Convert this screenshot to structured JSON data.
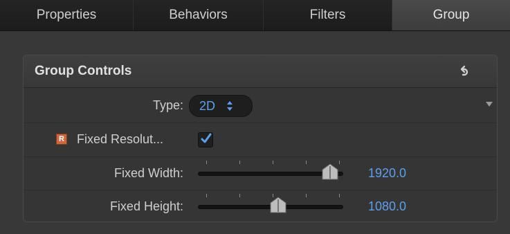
{
  "tabs": [
    {
      "label": "Properties",
      "active": false
    },
    {
      "label": "Behaviors",
      "active": false
    },
    {
      "label": "Filters",
      "active": false
    },
    {
      "label": "Group",
      "active": true
    }
  ],
  "panel": {
    "title": "Group Controls",
    "reset_icon": "reset-arrow-icon"
  },
  "rows": {
    "type": {
      "label": "Type:",
      "value": "2D"
    },
    "fixed_resolution": {
      "badge": "R",
      "label": "Fixed Resolut...",
      "checked": true
    },
    "fixed_width": {
      "label": "Fixed Width:",
      "value": "1920.0",
      "level": 0.91
    },
    "fixed_height": {
      "label": "Fixed Height:",
      "value": "1080.0",
      "level": 0.55
    }
  },
  "colors": {
    "accent": "#5aa0ec",
    "background": "#383838",
    "badge": "#d0673c"
  }
}
